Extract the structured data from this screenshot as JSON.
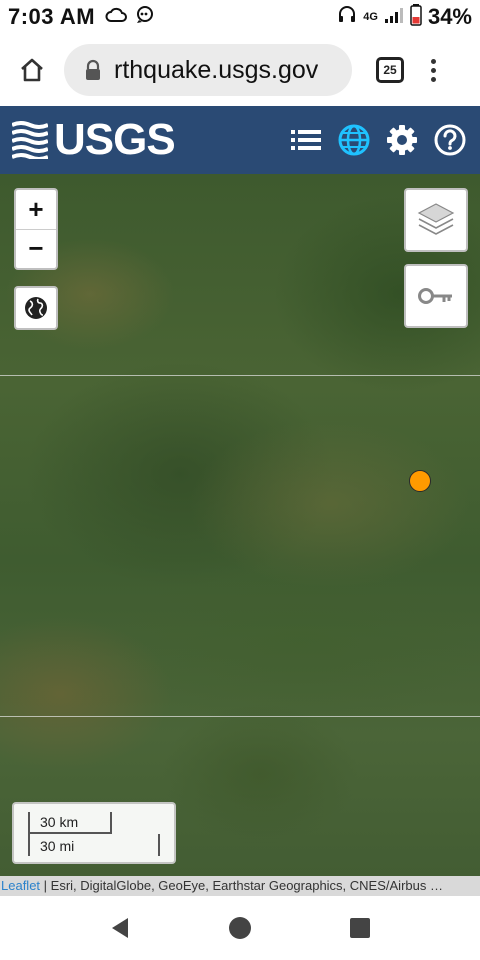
{
  "status_bar": {
    "time": "7:03 AM",
    "network": "4G",
    "battery": "34%"
  },
  "browser": {
    "url": "rthquake.usgs.gov",
    "tab_count": "25"
  },
  "header": {
    "logo_text": "USGS",
    "icons": [
      "list-icon",
      "globe-icon",
      "gear-icon",
      "help-icon"
    ],
    "active_icon_color": "#1fc2ff"
  },
  "map": {
    "zoom_in_label": "+",
    "zoom_out_label": "−",
    "scale_km": "30 km",
    "scale_mi": "30 mi",
    "marker_color": "#ff9a00",
    "attribution_link": "Leaflet",
    "attribution_text": " | Esri, DigitalGlobe, GeoEye, Earthstar Geographics, CNES/Airbus …"
  }
}
